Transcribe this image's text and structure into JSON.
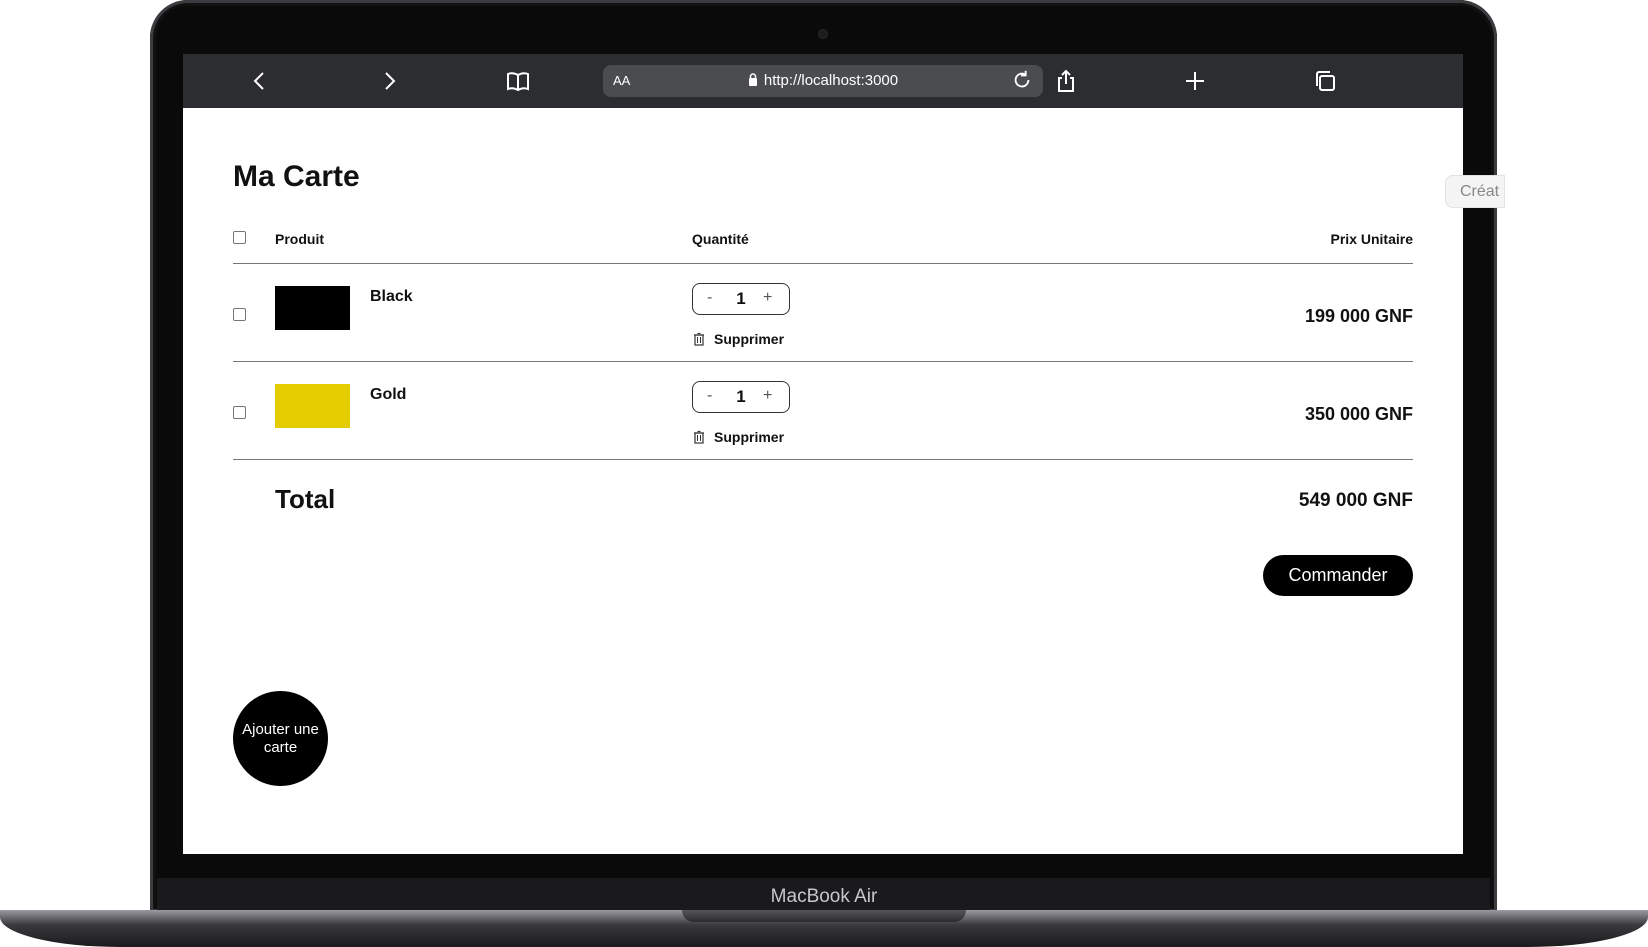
{
  "device": {
    "model_label": "MacBook Air"
  },
  "browser": {
    "text_size_label": "AA",
    "url": "http://localhost:3000"
  },
  "side_tab": {
    "label": "Créat"
  },
  "cart": {
    "title": "Ma Carte",
    "columns": {
      "product": "Produit",
      "quantity": "Quantité",
      "unit_price": "Prix Unitaire"
    },
    "items": [
      {
        "name": "Black",
        "swatch_color": "#000000",
        "quantity": "1",
        "remove_label": "Supprimer",
        "price": "199 000 GNF",
        "decrement": "-",
        "increment": "+"
      },
      {
        "name": "Gold",
        "swatch_color": "#e3cc00",
        "quantity": "1",
        "remove_label": "Supprimer",
        "price": "350 000 GNF",
        "decrement": "-",
        "increment": "+"
      }
    ],
    "total_label": "Total",
    "total_value": "549 000 GNF",
    "order_button": "Commander",
    "add_card_button": "Ajouter une carte"
  },
  "colors": {
    "primary": "#000000",
    "browser_bar": "#2b2d30",
    "url_field": "#4a4c50"
  },
  "icons": [
    "back-icon",
    "forward-icon",
    "bookmarks-icon",
    "lock-icon",
    "reload-icon",
    "share-icon",
    "new-tab-icon",
    "tabs-icon",
    "trash-icon"
  ]
}
